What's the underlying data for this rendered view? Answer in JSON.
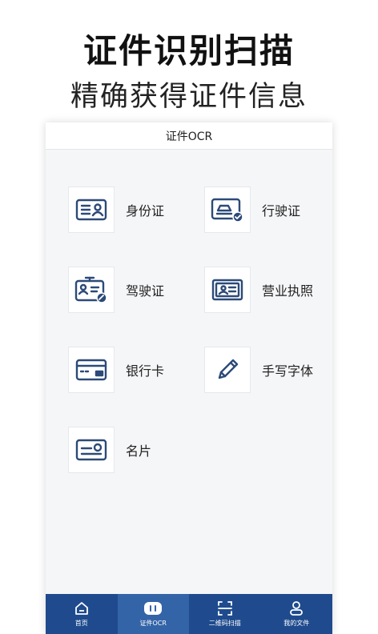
{
  "promo": {
    "title": "证件识别扫描",
    "subtitle": "精确获得证件信息"
  },
  "screen": {
    "title": "证件OCR"
  },
  "documents": [
    {
      "label": "身份证",
      "icon": "id-card-icon"
    },
    {
      "label": "行驶证",
      "icon": "vehicle-license-icon"
    },
    {
      "label": "驾驶证",
      "icon": "driver-license-icon"
    },
    {
      "label": "营业执照",
      "icon": "business-license-icon"
    },
    {
      "label": "银行卡",
      "icon": "bank-card-icon"
    },
    {
      "label": "手写字体",
      "icon": "pen-icon"
    },
    {
      "label": "名片",
      "icon": "business-card-icon"
    }
  ],
  "tabbar": {
    "tabs": [
      {
        "label": "首页",
        "icon": "home-icon",
        "active": false
      },
      {
        "label": "证件OCR",
        "icon": "ocr-icon",
        "active": true
      },
      {
        "label": "二维码扫描",
        "icon": "scan-icon",
        "active": false
      },
      {
        "label": "我的文件",
        "icon": "user-icon",
        "active": false
      }
    ]
  },
  "colors": {
    "accent": "#1f4b8e",
    "icon_stroke": "#2c4a78",
    "tab_active": "#3464a8"
  }
}
